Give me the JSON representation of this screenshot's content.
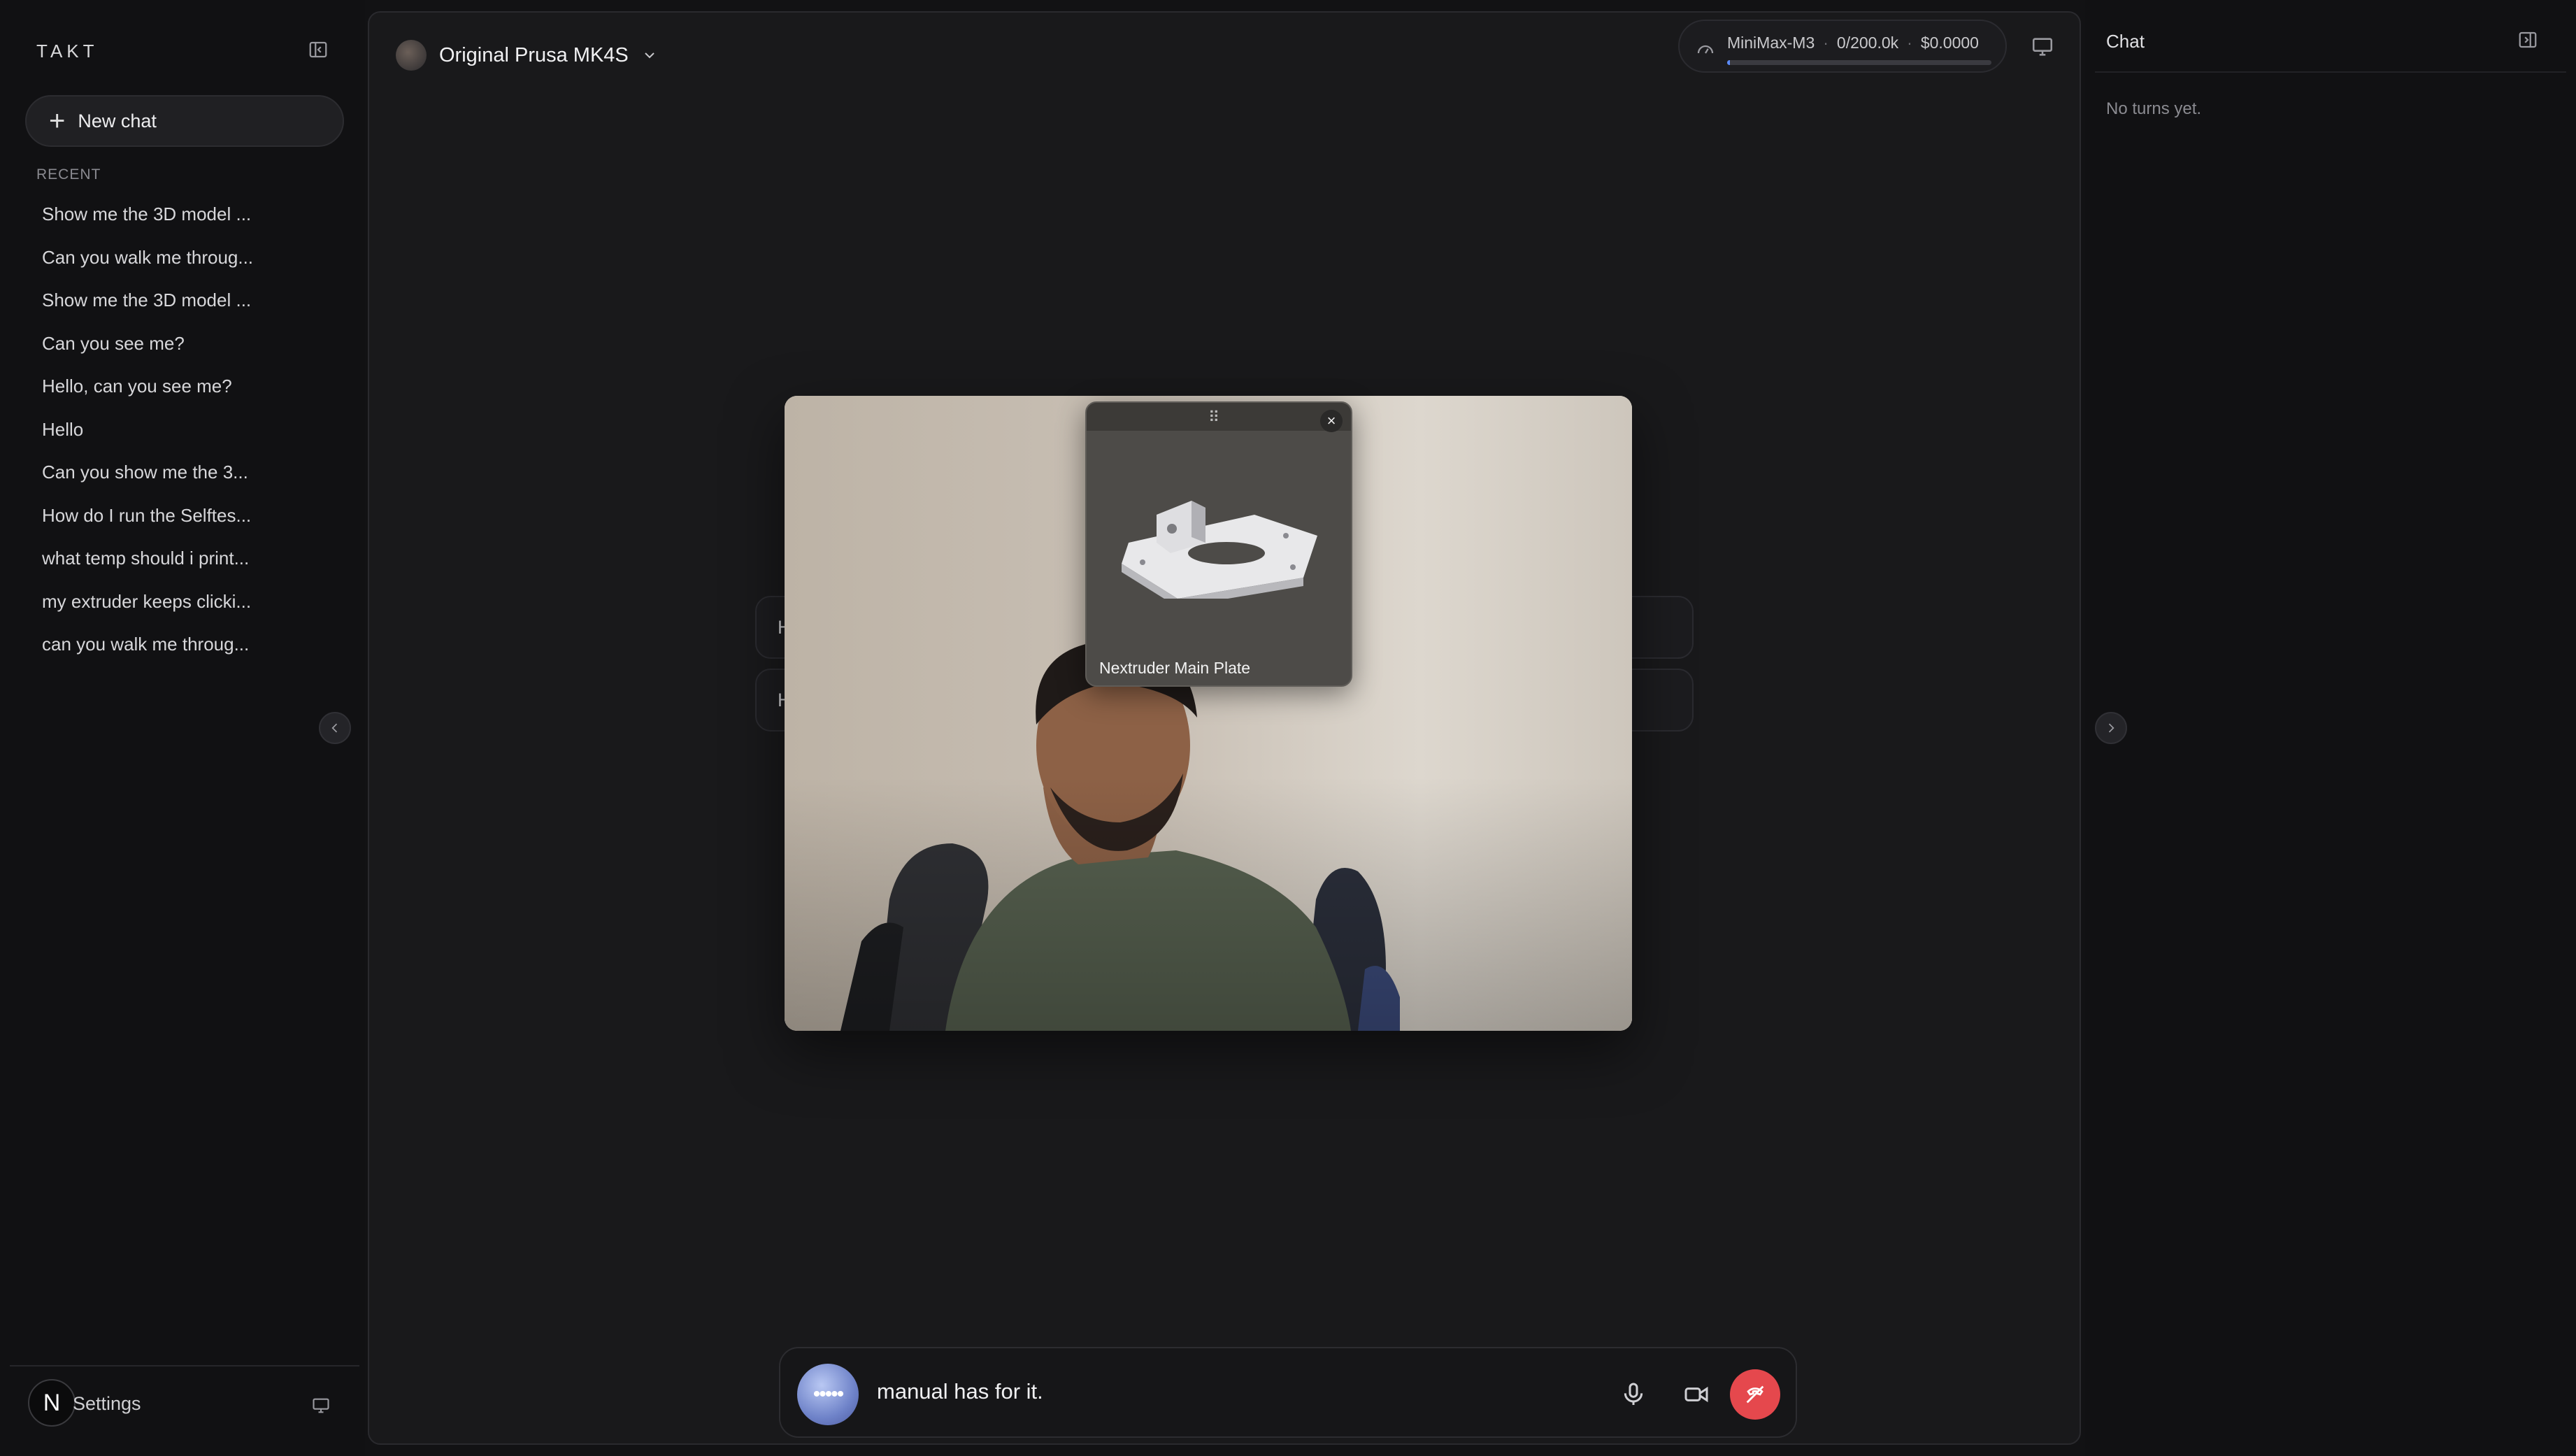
{
  "sidebar": {
    "brand": "TAKT",
    "new_chat_label": "New chat",
    "recent_label": "RECENT",
    "recent": [
      "Show me the 3D model ...",
      "Can you walk me throug...",
      "Show me the 3D model ...",
      "Can you see me?",
      "Hello, can you see me?",
      "Hello",
      "Can you show me the 3...",
      "How do I run the Selftes...",
      "what temp should i print...",
      "my extruder keeps clicki...",
      "can you walk me throug..."
    ],
    "user_initial": "N",
    "settings_label": "Settings"
  },
  "header": {
    "device_name": "Original Prusa MK4S",
    "model_name": "MiniMax-M3",
    "tokens": "0/200.0k",
    "cost": "$0.0000",
    "context_usage_fraction": 0.01
  },
  "background_messages": [
    "H",
    "H"
  ],
  "model_viewer": {
    "name": "Nextruder Main Plate"
  },
  "call": {
    "caption": "manual has for it.",
    "avatar_glyph": "•••••"
  },
  "right_panel": {
    "title": "Chat",
    "empty_text": "No turns yet."
  },
  "colors": {
    "accent": "#5b8cff",
    "end_call": "#e5484d"
  }
}
